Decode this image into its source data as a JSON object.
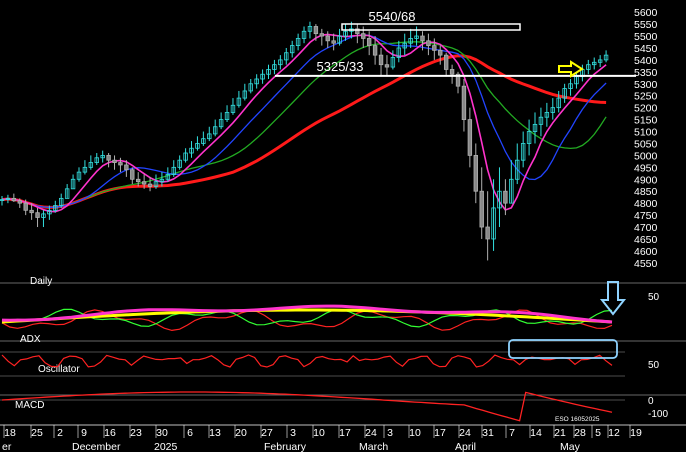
{
  "chart_data": {
    "type": "candlestick",
    "instrument_code": "ESO 16052025",
    "panels": {
      "price": {
        "y_ticks": [
          4550,
          4600,
          4650,
          4700,
          4750,
          4800,
          4850,
          4900,
          4950,
          5000,
          5050,
          5100,
          5150,
          5200,
          5250,
          5300,
          5350,
          5400,
          5450,
          5500,
          5550,
          5600
        ],
        "ylim": [
          4520,
          5630
        ],
        "grid": false,
        "annotations": [
          {
            "text": "5540/68",
            "level": 5540,
            "kind": "box"
          },
          {
            "text": "5325/33",
            "level": 5333,
            "kind": "line"
          }
        ],
        "arrow_color": "#ffff00",
        "candles_hlc": [
          [
            4830,
            4790,
            4815
          ],
          [
            4835,
            4800,
            4820
          ],
          [
            4840,
            4805,
            4810
          ],
          [
            4820,
            4780,
            4800
          ],
          [
            4815,
            4750,
            4770
          ],
          [
            4800,
            4730,
            4760
          ],
          [
            4780,
            4700,
            4740
          ],
          [
            4770,
            4700,
            4755
          ],
          [
            4790,
            4730,
            4770
          ],
          [
            4810,
            4760,
            4790
          ],
          [
            4840,
            4780,
            4820
          ],
          [
            4880,
            4820,
            4860
          ],
          [
            4920,
            4860,
            4900
          ],
          [
            4950,
            4890,
            4930
          ],
          [
            4980,
            4920,
            4950
          ],
          [
            5000,
            4940,
            4970
          ],
          [
            5010,
            4960,
            4990
          ],
          [
            5020,
            4970,
            5000
          ],
          [
            5010,
            4950,
            4980
          ],
          [
            5000,
            4940,
            4970
          ],
          [
            4990,
            4930,
            4960
          ],
          [
            4980,
            4910,
            4940
          ],
          [
            4950,
            4880,
            4900
          ],
          [
            4930,
            4870,
            4890
          ],
          [
            4920,
            4860,
            4880
          ],
          [
            4910,
            4850,
            4870
          ],
          [
            4920,
            4860,
            4890
          ],
          [
            4930,
            4870,
            4900
          ],
          [
            4950,
            4890,
            4920
          ],
          [
            4980,
            4910,
            4950
          ],
          [
            5000,
            4940,
            4980
          ],
          [
            5030,
            4970,
            5010
          ],
          [
            5060,
            4990,
            5030
          ],
          [
            5080,
            5020,
            5050
          ],
          [
            5100,
            5040,
            5070
          ],
          [
            5120,
            5060,
            5090
          ],
          [
            5150,
            5080,
            5120
          ],
          [
            5180,
            5110,
            5150
          ],
          [
            5210,
            5140,
            5180
          ],
          [
            5240,
            5170,
            5210
          ],
          [
            5270,
            5200,
            5240
          ],
          [
            5300,
            5230,
            5270
          ],
          [
            5320,
            5260,
            5300
          ],
          [
            5340,
            5280,
            5320
          ],
          [
            5360,
            5300,
            5340
          ],
          [
            5380,
            5320,
            5360
          ],
          [
            5400,
            5340,
            5380
          ],
          [
            5420,
            5360,
            5400
          ],
          [
            5450,
            5380,
            5430
          ],
          [
            5480,
            5410,
            5460
          ],
          [
            5510,
            5440,
            5490
          ],
          [
            5540,
            5470,
            5520
          ],
          [
            5560,
            5490,
            5540
          ],
          [
            5550,
            5480,
            5510
          ],
          [
            5530,
            5460,
            5500
          ],
          [
            5520,
            5450,
            5480
          ],
          [
            5510,
            5440,
            5470
          ],
          [
            5530,
            5460,
            5500
          ],
          [
            5550,
            5480,
            5520
          ],
          [
            5560,
            5490,
            5530
          ],
          [
            5550,
            5470,
            5510
          ],
          [
            5540,
            5450,
            5490
          ],
          [
            5520,
            5420,
            5460
          ],
          [
            5500,
            5380,
            5420
          ],
          [
            5450,
            5330,
            5380
          ],
          [
            5420,
            5330,
            5370
          ],
          [
            5440,
            5360,
            5410
          ],
          [
            5480,
            5390,
            5450
          ],
          [
            5510,
            5420,
            5470
          ],
          [
            5530,
            5450,
            5490
          ],
          [
            5540,
            5460,
            5500
          ],
          [
            5520,
            5440,
            5480
          ],
          [
            5510,
            5420,
            5460
          ],
          [
            5490,
            5400,
            5440
          ],
          [
            5460,
            5380,
            5420
          ],
          [
            5430,
            5330,
            5360
          ],
          [
            5380,
            5300,
            5340
          ],
          [
            5350,
            5260,
            5290
          ],
          [
            5320,
            5100,
            5150
          ],
          [
            5200,
            4950,
            5000
          ],
          [
            5050,
            4800,
            4850
          ],
          [
            4950,
            4650,
            4700
          ],
          [
            4850,
            4560,
            4650
          ],
          [
            4900,
            4600,
            4780
          ],
          [
            4950,
            4700,
            4850
          ],
          [
            4900,
            4750,
            4800
          ],
          [
            4980,
            4800,
            4900
          ],
          [
            5050,
            4880,
            4980
          ],
          [
            5100,
            4950,
            5050
          ],
          [
            5150,
            5000,
            5100
          ],
          [
            5180,
            5050,
            5130
          ],
          [
            5200,
            5080,
            5160
          ],
          [
            5220,
            5120,
            5180
          ],
          [
            5240,
            5150,
            5200
          ],
          [
            5270,
            5180,
            5240
          ],
          [
            5300,
            5220,
            5280
          ],
          [
            5320,
            5250,
            5300
          ],
          [
            5350,
            5280,
            5330
          ],
          [
            5380,
            5310,
            5360
          ],
          [
            5400,
            5340,
            5380
          ],
          [
            5410,
            5360,
            5390
          ],
          [
            5420,
            5370,
            5400
          ],
          [
            5440,
            5390,
            5420
          ]
        ]
      },
      "adx": {
        "label": "Daily",
        "title": "ADX",
        "y_ticks": [
          50
        ]
      },
      "oscillator": {
        "title": "Oscillator",
        "y_ticks": [
          50
        ]
      },
      "macd": {
        "title": "MACD",
        "y_ticks": [
          0,
          -100
        ]
      }
    },
    "x_ticks": [
      "18",
      "25",
      "2",
      "9",
      "16",
      "23",
      "30",
      "6",
      "13",
      "20",
      "27",
      "3",
      "10",
      "17",
      "24",
      "3",
      "10",
      "17",
      "24",
      "31",
      "7",
      "14",
      "21",
      "28",
      "5",
      "12",
      "19"
    ],
    "x_month_labels": [
      "er",
      "December",
      "2025",
      "February",
      "March",
      "April",
      "May"
    ]
  }
}
